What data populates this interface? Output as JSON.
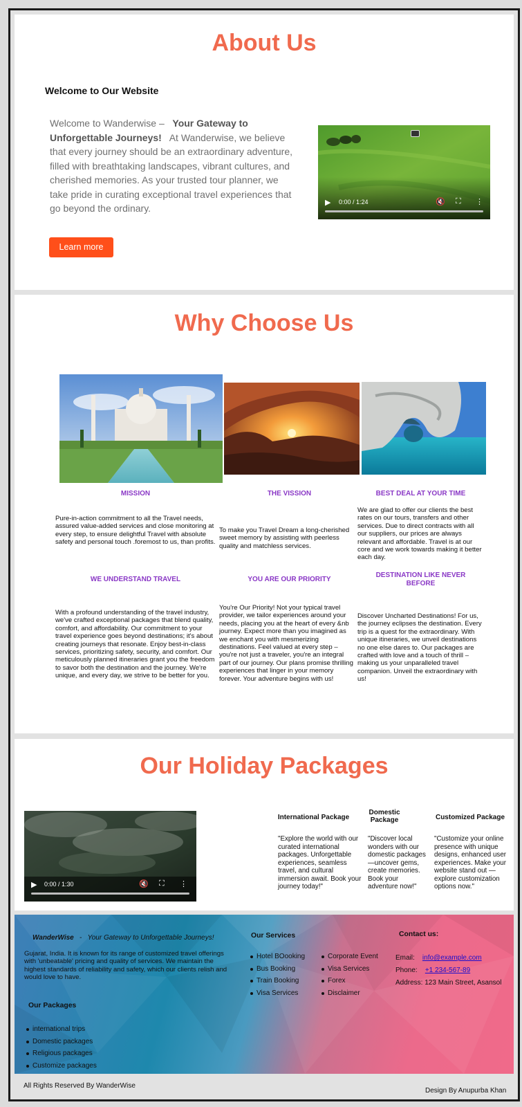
{
  "about": {
    "title": "About Us",
    "welcome_heading": "Welcome to Our Website",
    "intro_lead": "Welcome to Wanderwise –",
    "intro_bold": "Your Gateway to Unforgettable Journeys!",
    "intro_rest": "At Wanderwise, we believe that every journey should be an extraordinary adventure, filled with breathtaking landscapes, vibrant cultures, and cherished memories. As your trusted tour planner, we take pride in curating exceptional travel experiences that go beyond the ordinary.",
    "learn_more_label": "Learn more",
    "video": {
      "time": "0:00 / 1:24",
      "progress": 0
    }
  },
  "why": {
    "title": "Why Choose Us",
    "features": [
      {
        "title": "MISSION",
        "text": "Pure-in-action commitment to all the Travel needs, assured value-added services and close monitoring at every step, to ensure delightful Travel with absolute safety and personal touch .foremost to us, than profits."
      },
      {
        "title": "THE VISSION",
        "text": "To make you Travel Dream a long-cherished sweet memory by assisting with peerless quality and matchless services."
      },
      {
        "title": "BEST DEAL AT YOUR TIME",
        "text": "We are glad to offer our clients the best rates on our tours, transfers and other services. Due to direct contracts with all our suppliers, our prices are always relevant and affordable. Travel is at our core and we work towards making it better each day."
      },
      {
        "title": "WE UNDERSTAND TRAVEL",
        "text": "With a profound understanding of the travel industry, we've crafted exceptional packages that blend quality, comfort, and affordability.  Our commitment to your travel experience goes beyond destinations; it's about creating journeys that resonate. Enjoy best-in-class services, prioritizing safety, security, and comfort. Our meticulously planned itineraries grant you the freedom   to savor both the destination and the journey. We're unique, and every day, we strive to be better for you."
      },
      {
        "title": "YOU ARE OUR PRIORITY",
        "text": "You're Our Priority! Not your typical travel provider, we tailor experiences around your needs, placing you at the heart of every &nb journey. Expect more than you imagined as we enchant you with mesmerizing destinations. Feel  valued at every step – you're not just a traveler, you're an integral part of our journey. Our plans promise thrilling experiences that linger in your memory forever. Your adventure begins with us!"
      },
      {
        "title": "DESTINATION LIKE NEVER BEFORE",
        "text": "Discover Uncharted Destinations! For us, the journey eclipses the destination. Every trip is a quest for the extraordinary. With unique itineraries, we unveil destinations no one else dares to. Our packages are crafted with love and a touch of thrill – making us your unparalleled travel companion. Unveil the extraordinary with us!"
      }
    ]
  },
  "packages": {
    "title": "Our Holiday Packages",
    "video": {
      "time": "0:00 / 1:30",
      "progress": 0
    },
    "items": [
      {
        "title": "International Package",
        "text": "\"Explore the world with our curated international packages. Unforgettable experiences, seamless travel, and cultural immersion await. Book your journey today!\""
      },
      {
        "title": "Domestic Package",
        "text": "\"Discover local wonders with our domestic packages—uncover gems, create memories. Book your adventure now!\""
      },
      {
        "title": "Customized Package",
        "text": "\"Customize your online presence with unique designs, enhanced user experiences. Make your website stand out — explore customization options now.\""
      }
    ]
  },
  "footer": {
    "brand": "WanderWise",
    "separator": "-",
    "tagline": "Your Gateway to Unforgettable Journeys!",
    "about_text": "Gujarat, India. It is known for its range of customized travel offerings with 'unbeatable' pricing and quality of services. We maintain the highest standards of reliability and safety, which our clients relish and would love to have.",
    "packages_heading": "Our Packages",
    "packages": [
      "international trips",
      "Domestic packages",
      "Religious packages",
      "Customize packages"
    ],
    "services_heading": "Our Services",
    "services_col1": [
      "Hotel BOooking",
      "Bus Booking",
      "Train Booking",
      "Visa Services"
    ],
    "services_col2": [
      "Corporate Event",
      "Visa Services",
      "Forex",
      "Disclaimer"
    ],
    "contact_heading": "Contact us:",
    "email_label": "Email:",
    "email": "info@example.com",
    "phone_label": "Phone:",
    "phone": "+1 234-567-89",
    "address": "Address: 123 Main Street, Asansol"
  },
  "bottom": {
    "rights": "All Rights Reserved By WanderWise",
    "design": "Design By Anupurba Khan"
  },
  "colors": {
    "heading": "#f06a4e",
    "accent_button": "#ff4f1a",
    "feature_title": "#8a38c6",
    "link": "#1a0dcc"
  }
}
